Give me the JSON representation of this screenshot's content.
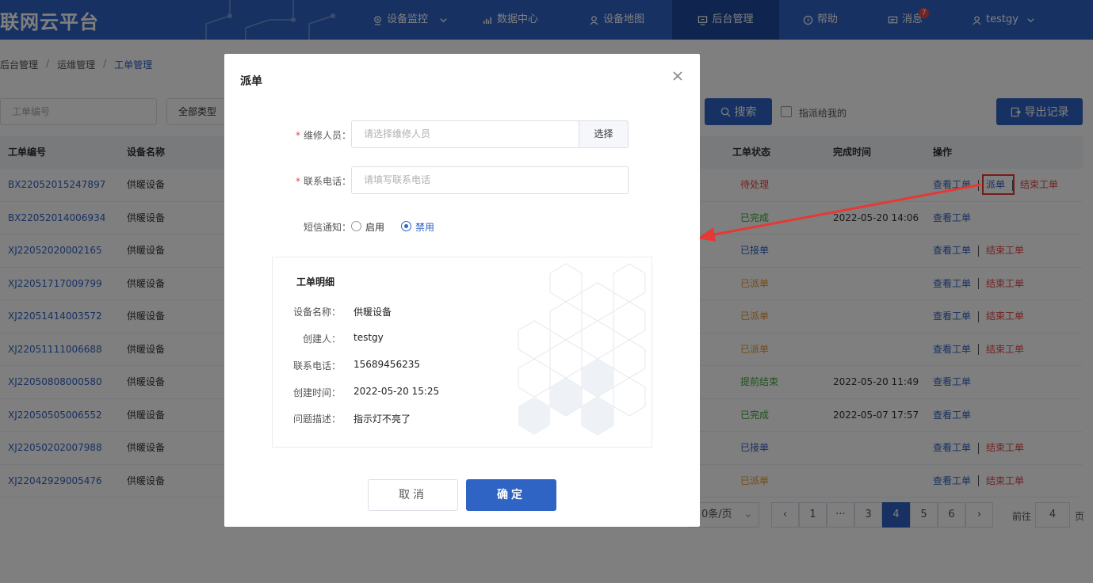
{
  "nav": {
    "logo": "联网云平台",
    "items": [
      {
        "label": "设备监控",
        "icon": "location-icon"
      },
      {
        "label": "数据中心",
        "icon": "chart-icon"
      },
      {
        "label": "设备地图",
        "icon": "user-map-icon"
      },
      {
        "label": "后台管理",
        "icon": "admin-icon"
      },
      {
        "label": "帮助",
        "icon": "help-icon"
      },
      {
        "label": "消息",
        "icon": "message-icon",
        "badge": "7"
      },
      {
        "label": "testgy",
        "icon": "user-icon"
      }
    ]
  },
  "breadcrumb": [
    "后台管理",
    "运维管理",
    "工单管理"
  ],
  "filters": {
    "order_no_placeholder": "工单编号",
    "type_value": "全部类型",
    "search_label": "搜索",
    "assigned_to_me_label": "指派给我的",
    "export_label": "导出记录"
  },
  "table": {
    "headers": {
      "order_no": "工单编号",
      "device": "设备名称",
      "status": "工单状态",
      "finish_time": "完成时间",
      "ops": "操作"
    },
    "rows": [
      {
        "order_no": "BX22052015247897",
        "device": "供暖设备",
        "status": "待处理",
        "status_class": "status-pending",
        "finish_time": "",
        "ops": [
          "查看工单",
          "派单",
          "结束工单"
        ]
      },
      {
        "order_no": "BX22052014006934",
        "device": "供暖设备",
        "status": "已完成",
        "status_class": "status-done",
        "finish_time": "2022-05-20 14:06",
        "ops": [
          "查看工单"
        ]
      },
      {
        "order_no": "XJ22052020002165",
        "device": "供暖设备",
        "status": "已接单",
        "status_class": "status-accepted",
        "finish_time": "",
        "ops": [
          "查看工单",
          "结束工单"
        ]
      },
      {
        "order_no": "XJ22051717009799",
        "device": "供暖设备",
        "status": "已派单",
        "status_class": "status-dispatched",
        "finish_time": "",
        "ops": [
          "查看工单",
          "结束工单"
        ]
      },
      {
        "order_no": "XJ22051414003572",
        "device": "供暖设备",
        "status": "已派单",
        "status_class": "status-dispatched",
        "finish_time": "",
        "ops": [
          "查看工单",
          "结束工单"
        ]
      },
      {
        "order_no": "XJ22051111006688",
        "device": "供暖设备",
        "status": "已派单",
        "status_class": "status-dispatched",
        "finish_time": "",
        "ops": [
          "查看工单",
          "结束工单"
        ]
      },
      {
        "order_no": "XJ22050808000580",
        "device": "供暖设备",
        "status": "提前结束",
        "status_class": "status-early",
        "finish_time": "2022-05-20 11:49",
        "ops": [
          "查看工单"
        ]
      },
      {
        "order_no": "XJ22050505006552",
        "device": "供暖设备",
        "status": "已完成",
        "status_class": "status-done",
        "finish_time": "2022-05-07 17:57",
        "ops": [
          "查看工单"
        ]
      },
      {
        "order_no": "XJ22050202007988",
        "device": "供暖设备",
        "status": "已接单",
        "status_class": "status-accepted",
        "finish_time": "",
        "ops": [
          "查看工单",
          "结束工单"
        ]
      },
      {
        "order_no": "XJ22042929005476",
        "device": "供暖设备",
        "status": "已派单",
        "status_class": "status-dispatched",
        "finish_time": "",
        "ops": [
          "查看工单",
          "结束工单"
        ]
      }
    ]
  },
  "pagination": {
    "page_size": "0条/页",
    "prev": "‹",
    "pages": [
      "1",
      "···",
      "3",
      "4",
      "5",
      "6"
    ],
    "current": "4",
    "next": "›",
    "goto_prefix": "前往",
    "goto_value": "4",
    "goto_suffix": "页"
  },
  "modal": {
    "title": "派单",
    "close_icon": "close-icon",
    "repair_label": "维修人员：",
    "repair_placeholder": "请选择维修人员",
    "select_label": "选择",
    "phone_label": "联系电话：",
    "phone_placeholder": "请填写联系电话",
    "sms_label": "短信通知：",
    "sms_enable": "启用",
    "sms_disable": "禁用",
    "sms_selected": "禁用",
    "detail": {
      "title": "工单明细",
      "items": [
        {
          "label": "设备名称：",
          "value": "供暖设备"
        },
        {
          "label": "创建人：",
          "value": "testgy"
        },
        {
          "label": "联系电话：",
          "value": "15689456235"
        },
        {
          "label": "创建时间：",
          "value": "2022-05-20 15:25"
        },
        {
          "label": "问题描述：",
          "value": "指示灯不亮了"
        }
      ]
    },
    "cancel_label": "取消",
    "ok_label": "确定"
  },
  "colors": {
    "primary": "#2f63c4",
    "danger": "#e54646",
    "success": "#3aa637",
    "warning": "#e69a2e",
    "annotation": "#e53935"
  }
}
